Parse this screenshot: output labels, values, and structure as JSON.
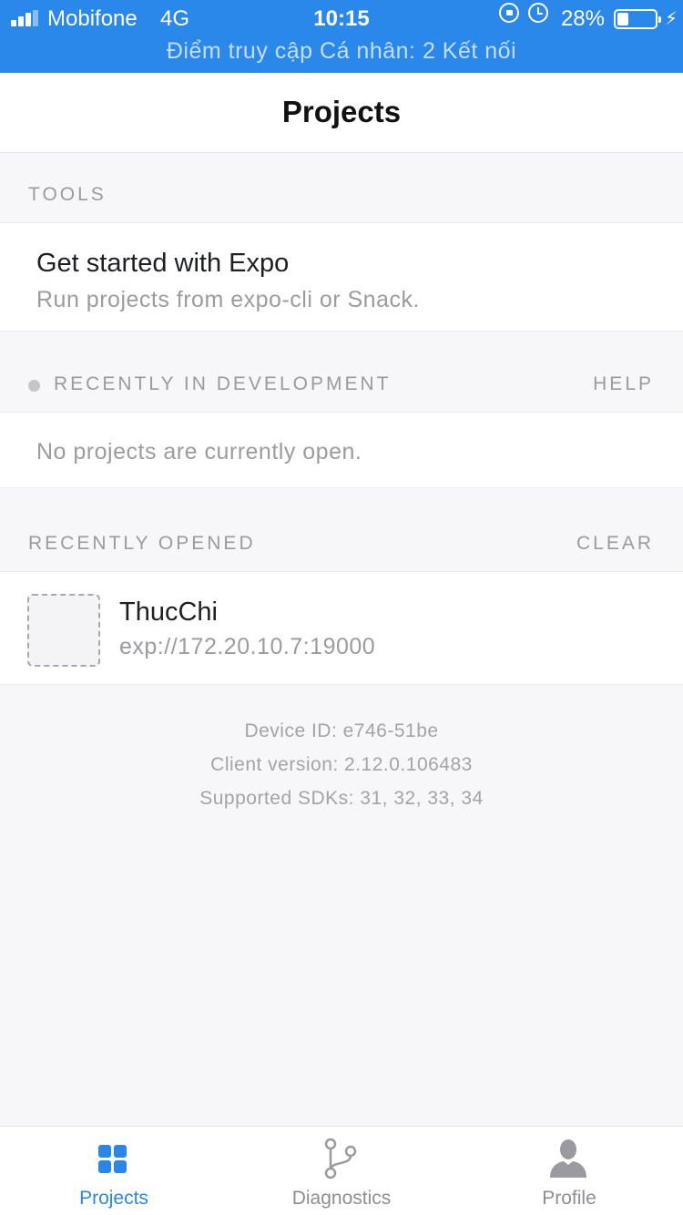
{
  "status_bar": {
    "carrier": "Mobifone",
    "network": "4G",
    "time": "10:15",
    "battery": "28%",
    "hotspot": "Điểm truy cập Cá nhân: 2 Kết nối",
    "icons": [
      "signal-icon",
      "orientation-lock-icon",
      "alarm-icon",
      "battery-icon",
      "charging-icon"
    ]
  },
  "nav": {
    "title": "Projects"
  },
  "tools": {
    "header": "TOOLS",
    "item_title": "Get started with Expo",
    "item_subtitle": "Run projects from expo-cli or Snack."
  },
  "development": {
    "header": "RECENTLY IN DEVELOPMENT",
    "action": "HELP",
    "empty": "No projects are currently open."
  },
  "recent": {
    "header": "RECENTLY OPENED",
    "action": "CLEAR",
    "projects": [
      {
        "name": "ThucChi",
        "url": "exp://172.20.10.7:19000"
      }
    ]
  },
  "device_info": {
    "device_id": "Device ID: e746-51be",
    "client_version": "Client version: 2.12.0.106483",
    "sdks": "Supported SDKs: 31, 32, 33, 34"
  },
  "tabs": [
    {
      "label": "Projects",
      "icon": "grid-icon",
      "active": true
    },
    {
      "label": "Diagnostics",
      "icon": "branch-icon",
      "active": false
    },
    {
      "label": "Profile",
      "icon": "person-icon",
      "active": false
    }
  ],
  "colors": {
    "status_bar": "#2a88ea",
    "accent": "#2a86e8",
    "background": "#f7f7f9",
    "muted": "#9a9aa0"
  }
}
